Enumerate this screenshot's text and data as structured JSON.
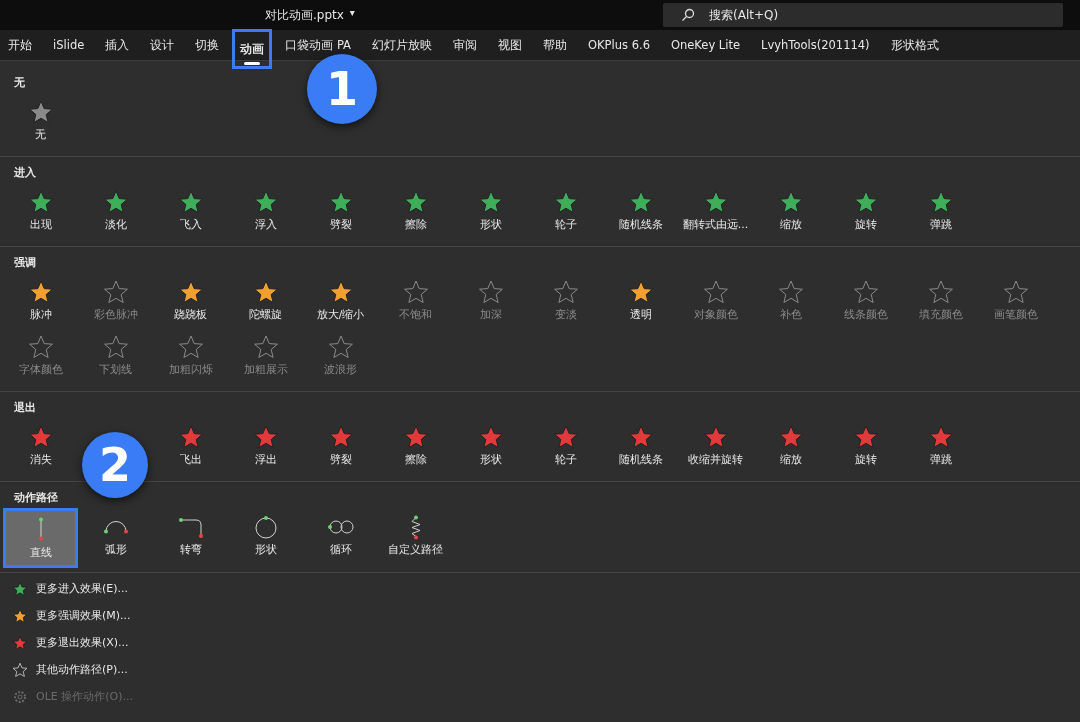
{
  "title_bar": {
    "file_name": "对比动画.pptx",
    "dropdown": "▾",
    "search": {
      "placeholder": "搜索(Alt+Q)"
    }
  },
  "ribbon_tabs": [
    {
      "label": "开始",
      "selected": false,
      "callout": false
    },
    {
      "label": "iSlide",
      "selected": false,
      "callout": false
    },
    {
      "label": "插入",
      "selected": false,
      "callout": false
    },
    {
      "label": "设计",
      "selected": false,
      "callout": false
    },
    {
      "label": "切换",
      "selected": false,
      "callout": false
    },
    {
      "label": "动画",
      "selected": true,
      "callout": true
    },
    {
      "label": "口袋动画 PA",
      "selected": false,
      "callout": false
    },
    {
      "label": "幻灯片放映",
      "selected": false,
      "callout": false
    },
    {
      "label": "审阅",
      "selected": false,
      "callout": false
    },
    {
      "label": "视图",
      "selected": false,
      "callout": false
    },
    {
      "label": "帮助",
      "selected": false,
      "callout": false
    },
    {
      "label": "OKPlus 6.6",
      "selected": false,
      "callout": false
    },
    {
      "label": "OneKey Lite",
      "selected": false,
      "callout": false
    },
    {
      "label": "LvyhTools(201114)",
      "selected": false,
      "callout": false
    },
    {
      "label": "形状格式",
      "selected": false,
      "callout": false
    }
  ],
  "gallery": {
    "sections": [
      {
        "title": "无",
        "kind": "none",
        "items": [
          {
            "label": "无",
            "disabled": false
          }
        ]
      },
      {
        "title": "进入",
        "kind": "entrance",
        "items": [
          {
            "label": "出现",
            "disabled": false
          },
          {
            "label": "淡化",
            "disabled": false
          },
          {
            "label": "飞入",
            "disabled": false
          },
          {
            "label": "浮入",
            "disabled": false
          },
          {
            "label": "劈裂",
            "disabled": false
          },
          {
            "label": "擦除",
            "disabled": false
          },
          {
            "label": "形状",
            "disabled": false
          },
          {
            "label": "轮子",
            "disabled": false
          },
          {
            "label": "随机线条",
            "disabled": false
          },
          {
            "label": "翻转式由远...",
            "disabled": false
          },
          {
            "label": "缩放",
            "disabled": false
          },
          {
            "label": "旋转",
            "disabled": false
          },
          {
            "label": "弹跳",
            "disabled": false
          }
        ]
      },
      {
        "title": "强调",
        "kind": "emphasis",
        "items": [
          {
            "label": "脉冲",
            "disabled": false
          },
          {
            "label": "彩色脉冲",
            "disabled": true
          },
          {
            "label": "跷跷板",
            "disabled": false
          },
          {
            "label": "陀螺旋",
            "disabled": false
          },
          {
            "label": "放大/缩小",
            "disabled": false
          },
          {
            "label": "不饱和",
            "disabled": true
          },
          {
            "label": "加深",
            "disabled": true
          },
          {
            "label": "变淡",
            "disabled": true
          },
          {
            "label": "透明",
            "disabled": false
          },
          {
            "label": "对象颜色",
            "disabled": true
          },
          {
            "label": "补色",
            "disabled": true
          },
          {
            "label": "线条颜色",
            "disabled": true
          },
          {
            "label": "填充颜色",
            "disabled": true
          },
          {
            "label": "画笔颜色",
            "disabled": true
          },
          {
            "label": "字体颜色",
            "disabled": true
          },
          {
            "label": "下划线",
            "disabled": true
          },
          {
            "label": "加粗闪烁",
            "disabled": true
          },
          {
            "label": "加粗展示",
            "disabled": true
          },
          {
            "label": "波浪形",
            "disabled": true
          }
        ]
      },
      {
        "title": "退出",
        "kind": "exit",
        "items": [
          {
            "label": "消失",
            "disabled": false
          },
          {
            "kind": "covered"
          },
          {
            "label": "飞出",
            "disabled": false
          },
          {
            "label": "浮出",
            "disabled": false
          },
          {
            "label": "劈裂",
            "disabled": false
          },
          {
            "label": "擦除",
            "disabled": false
          },
          {
            "label": "形状",
            "disabled": false
          },
          {
            "label": "轮子",
            "disabled": false
          },
          {
            "label": "随机线条",
            "disabled": false
          },
          {
            "label": "收缩并旋转",
            "disabled": false
          },
          {
            "label": "缩放",
            "disabled": false
          },
          {
            "label": "旋转",
            "disabled": false
          },
          {
            "label": "弹跳",
            "disabled": false
          }
        ]
      },
      {
        "title": "动作路径",
        "kind": "path",
        "items": [
          {
            "label": "直线",
            "kind": "line",
            "selected": true,
            "callout": true
          },
          {
            "label": "弧形",
            "kind": "arc",
            "selected": false,
            "callout": false
          },
          {
            "label": "转弯",
            "kind": "turn",
            "selected": false,
            "callout": false
          },
          {
            "label": "形状",
            "kind": "circle",
            "selected": false,
            "callout": false
          },
          {
            "label": "循环",
            "kind": "loop",
            "selected": false,
            "callout": false
          },
          {
            "label": "自定义路径",
            "kind": "custom",
            "selected": false,
            "callout": false
          }
        ]
      }
    ],
    "menu": [
      {
        "label": "更多进入效果(E)...",
        "kind": "entrance",
        "disabled": false
      },
      {
        "label": "更多强调效果(M)...",
        "kind": "emphasis",
        "disabled": false
      },
      {
        "label": "更多退出效果(X)...",
        "kind": "exit",
        "disabled": false
      },
      {
        "label": "其他动作路径(P)...",
        "kind": "path",
        "disabled": false
      },
      {
        "label": "OLE 操作动作(O)...",
        "kind": "ole",
        "disabled": true
      }
    ]
  },
  "callout_badges": [
    "1",
    "2"
  ]
}
